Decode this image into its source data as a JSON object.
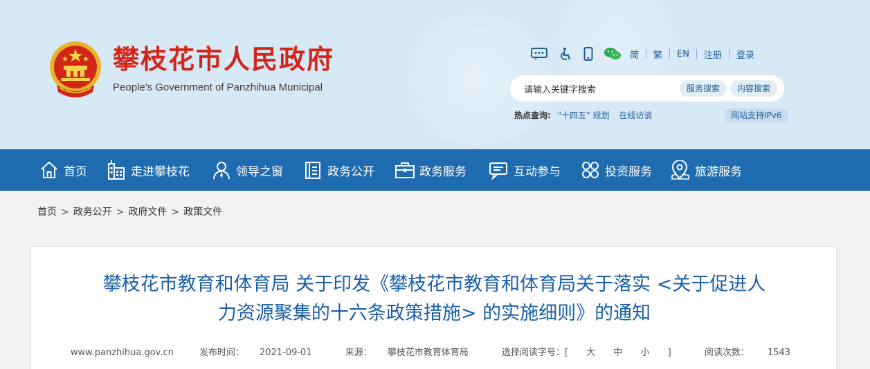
{
  "header": {
    "site_title": "攀枝花市人民政府",
    "site_subtitle": "People's Government of Panzhihua Municipal",
    "toolbar": {
      "icons": [
        "message-icon",
        "accessibility-icon",
        "mobile-icon",
        "wechat-icon"
      ],
      "simplified": "简",
      "traditional": "繁",
      "english": "EN",
      "register": "注册",
      "login": "登录"
    },
    "search": {
      "placeholder": "请输入关键字搜索",
      "service_search": "服务搜索",
      "content_search": "内容搜索"
    },
    "hot": {
      "label": "热点查询:",
      "items": [
        "\"十四五\" 规划",
        "在线访谈"
      ]
    },
    "ipv6": "网站支持IPv6"
  },
  "nav": {
    "items": [
      {
        "label": "首页",
        "icon": "home-icon"
      },
      {
        "label": "走进攀枝花",
        "icon": "building-icon"
      },
      {
        "label": "领导之窗",
        "icon": "person-icon"
      },
      {
        "label": "政务公开",
        "icon": "document-icon"
      },
      {
        "label": "政务服务",
        "icon": "briefcase-icon"
      },
      {
        "label": "互动参与",
        "icon": "chat-icon"
      },
      {
        "label": "投资服务",
        "icon": "grid-icon"
      },
      {
        "label": "旅游服务",
        "icon": "map-pin-icon"
      }
    ]
  },
  "breadcrumb": {
    "items": [
      "首页",
      "政务公开",
      "政府文件",
      "政策文件"
    ],
    "separator": ">"
  },
  "article": {
    "title_line1": "攀枝花市教育和体育局 关于印发《攀枝花市教育和体育局关于落实 <关于促进人",
    "title_line2": "力资源聚集的十六条政策措施> 的实施细则》的通知",
    "source_site": "www.panzhihua.gov.cn",
    "publish_label": "发布时间：",
    "publish_date": "2021-09-01",
    "source_label": "来源：",
    "source": "攀枝花市教育体育局",
    "fontsize_label": "选择阅读字号：[",
    "fontsize_large": "大",
    "fontsize_medium": "中",
    "fontsize_small": "小",
    "fontsize_end": "]",
    "views_label": "阅读次数：",
    "views": "1543"
  },
  "colors": {
    "header_bg": "#d8e9f6",
    "nav_bg": "#1f6baf",
    "title_red": "#d3261a",
    "article_title_blue": "#1a5fa6"
  }
}
